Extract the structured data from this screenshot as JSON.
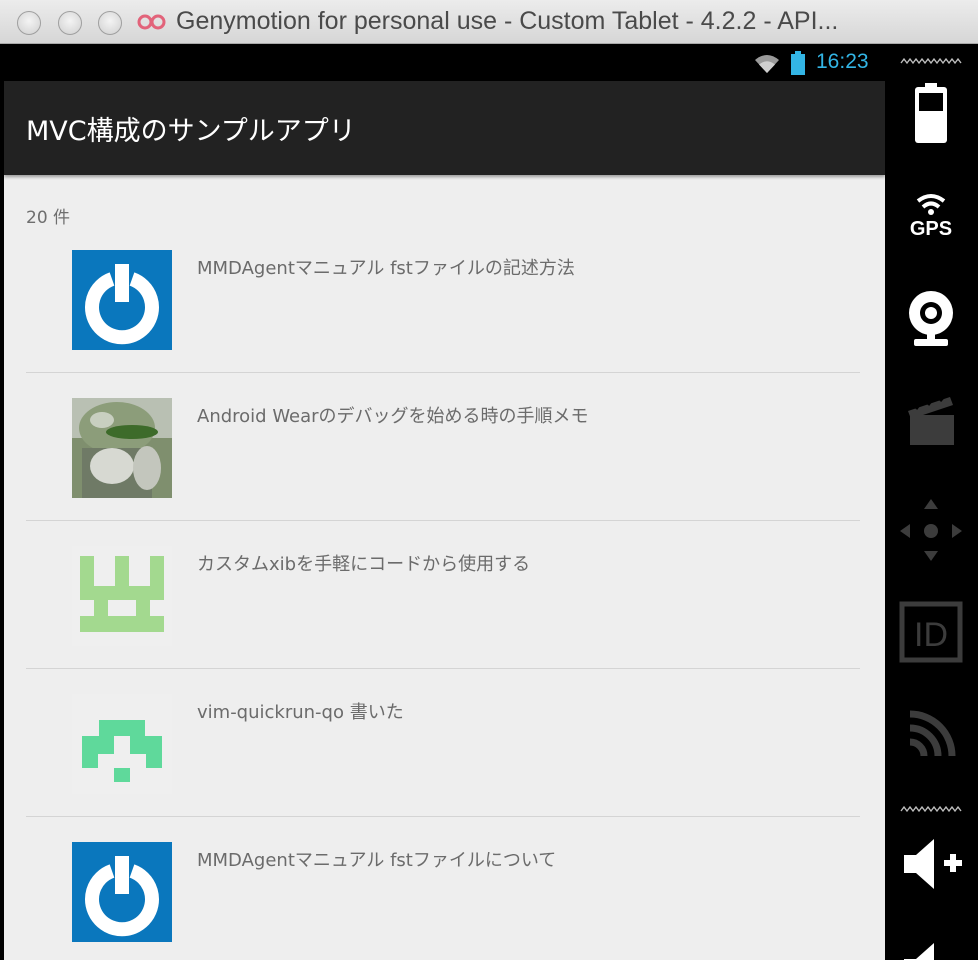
{
  "window": {
    "title": "Genymotion for personal use - Custom Tablet - 4.2.2 - API..."
  },
  "status_bar": {
    "time": "16:23",
    "icons": [
      "wifi-icon",
      "battery-icon"
    ]
  },
  "action_bar": {
    "title": "MVC構成のサンプルアプリ"
  },
  "list": {
    "count_label": "20 件",
    "items": [
      {
        "title": "MMDAgentマニュアル fstファイルの記述方法",
        "thumbnail": "power-logo-thumbnail"
      },
      {
        "title": "Android Wearのデバッグを始める時の手順メモ",
        "thumbnail": "photo-avatar-thumbnail"
      },
      {
        "title": "カスタムxibを手軽にコードから使用する",
        "thumbnail": "pixel-identicon-green"
      },
      {
        "title": "vim-quickrun-qo 書いた",
        "thumbnail": "pixel-identicon-mint"
      },
      {
        "title": "MMDAgentマニュアル fstファイルについて",
        "thumbnail": "power-logo-thumbnail"
      }
    ]
  },
  "sidebar": {
    "tools": [
      "battery-icon",
      "gps-icon",
      "webcam-icon",
      "clapperboard-icon",
      "dpad-icon",
      "id-icon",
      "broadcast-icon",
      "volume-up-icon",
      "volume-down-icon"
    ],
    "gps_label": "GPS",
    "id_label": "ID"
  },
  "colors": {
    "status_time": "#33b5e5",
    "action_bar": "#222222",
    "list_background": "#eeeeee",
    "power_logo_blue": "#0a77bd",
    "identicon_green": "#a3d98f",
    "identicon_mint": "#5fd99b"
  }
}
